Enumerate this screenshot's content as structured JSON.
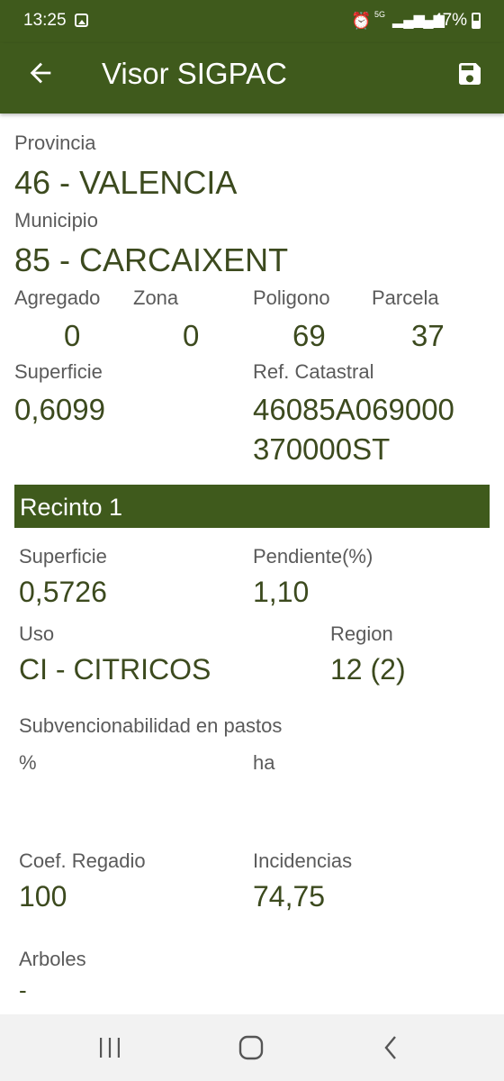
{
  "status_bar": {
    "time": "13:25",
    "network": "5G",
    "battery": "47%"
  },
  "app_bar": {
    "title": "Visor SIGPAC"
  },
  "parcel": {
    "provincia_label": "Provincia",
    "provincia_value": "46 - VALENCIA",
    "municipio_label": "Municipio",
    "municipio_value": "85 - CARCAIXENT",
    "agregado_label": "Agregado",
    "agregado_value": "0",
    "zona_label": "Zona",
    "zona_value": "0",
    "poligono_label": "Poligono",
    "poligono_value": "69",
    "parcela_label": "Parcela",
    "parcela_value": "37",
    "superficie_label": "Superficie",
    "superficie_value": "0,6099",
    "ref_label": "Ref. Catastral",
    "ref_line1": "46085A069000",
    "ref_line2": "370000ST"
  },
  "recinto": {
    "header": "Recinto 1",
    "superficie_label": "Superficie",
    "superficie_value": "0,5726",
    "pendiente_label": "Pendiente(%)",
    "pendiente_value": "1,10",
    "uso_label": "Uso",
    "uso_value": "CI - CITRICOS",
    "region_label": "Region",
    "region_value": "12 (2)",
    "pastos_label": "Subvencionabilidad en pastos",
    "pastos_pct_label": "%",
    "pastos_ha_label": "ha",
    "coef_label": "Coef. Regadio",
    "coef_value": "100",
    "incidencias_label": "Incidencias",
    "incidencias_value": "74,75",
    "arboles_label": "Arboles",
    "arboles_value": "-"
  },
  "colors": {
    "primary": "#3f5a1c",
    "value_text": "#3c4a1e",
    "label_text": "#5a5a5a"
  }
}
